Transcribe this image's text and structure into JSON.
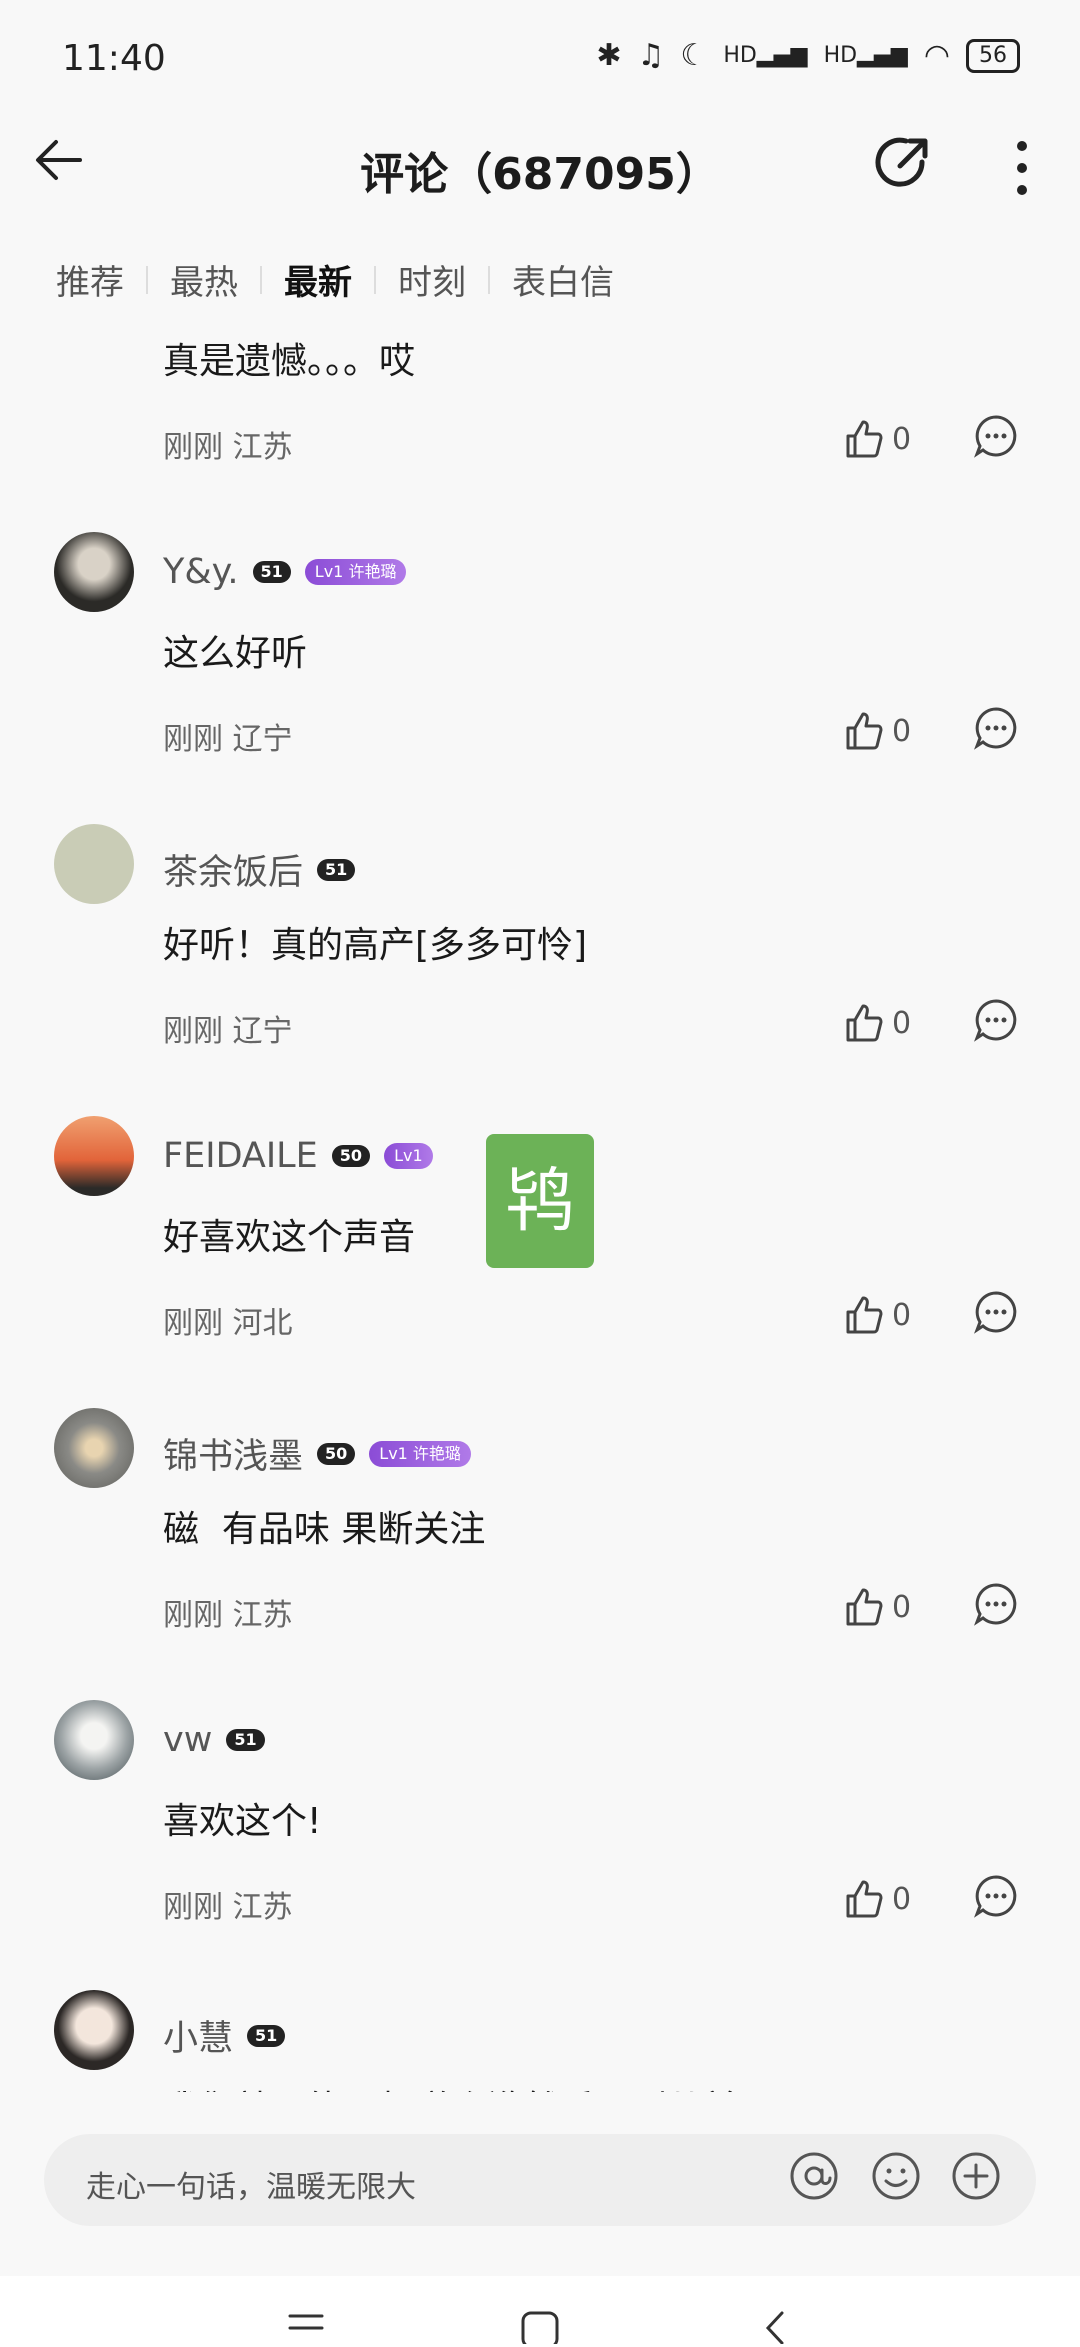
{
  "status": {
    "time": "11:40",
    "battery": "56"
  },
  "header": {
    "title": "评论（687095）"
  },
  "tabs": [
    {
      "label": "推荐",
      "active": false
    },
    {
      "label": "最热",
      "active": false
    },
    {
      "label": "最新",
      "active": true
    },
    {
      "label": "时刻",
      "active": false
    },
    {
      "label": "表白信",
      "active": false
    }
  ],
  "comments": [
    {
      "user": "",
      "text": "真是遗憾。。。哎",
      "time": "刚刚",
      "location": "江苏",
      "likes": "0"
    },
    {
      "user": "Y&y.",
      "badge": "51",
      "level": "Lv1 许艳璐",
      "text": "这么好听",
      "time": "刚刚",
      "location": "辽宁",
      "likes": "0"
    },
    {
      "user": "茶余饭后",
      "badge": "51",
      "text": "好听！真的高产[多多可怜]",
      "time": "刚刚",
      "location": "辽宁",
      "likes": "0"
    },
    {
      "user": "FEIDAILE",
      "badge": "50",
      "level": "Lv1",
      "text": "好喜欢这个声音",
      "time": "刚刚",
      "location": "河北",
      "likes": "0"
    },
    {
      "user": "锦书浅墨",
      "badge": "50",
      "level": "Lv1 许艳璐",
      "text": "磁  有品味 果断关注",
      "time": "刚刚",
      "location": "江苏",
      "likes": "0"
    },
    {
      "user": "vw",
      "badge": "51",
      "text": "喜欢这个!",
      "time": "刚刚",
      "location": "江苏",
      "likes": "0"
    },
    {
      "user": "小慧",
      "badge": "51",
      "text": "我们就不能互相道个歉然后回到从前吗?",
      "time": "",
      "location": "",
      "likes": ""
    }
  ],
  "floating_tile": "鸨",
  "input": {
    "placeholder": "走心一句话，温暖无限大"
  },
  "colors": {
    "accent_level": "#9b5de5",
    "tile_green": "#6cb257"
  }
}
